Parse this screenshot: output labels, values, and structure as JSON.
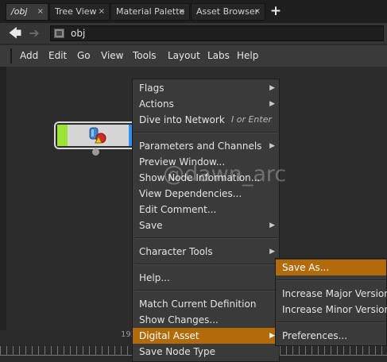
{
  "tabs": [
    {
      "label": "/obj",
      "close": "×"
    },
    {
      "label": "Tree View",
      "close": "×"
    },
    {
      "label": "Material Palette",
      "close": "×"
    },
    {
      "label": "Asset Browser",
      "close": "×"
    }
  ],
  "add_tab": "+",
  "path": {
    "back": "🡄",
    "forward": "➔",
    "value": "obj"
  },
  "menubar": [
    "Add",
    "Edit",
    "Go",
    "View",
    "Tools",
    "Layout",
    "Labs",
    "Help"
  ],
  "timeline": {
    "frame_label": "192"
  },
  "context_menu": {
    "items": [
      {
        "label": "Flags",
        "arrow": "▶"
      },
      {
        "label": "Actions",
        "arrow": "▶"
      },
      {
        "label": "Dive into Network",
        "hint": "I or Enter"
      },
      {
        "label": "Parameters and Channels",
        "arrow": "▶"
      },
      {
        "label": "Preview Window..."
      },
      {
        "label": "Show Node Information..."
      },
      {
        "label": "View Dependencies..."
      },
      {
        "label": "Edit Comment..."
      },
      {
        "label": "Save",
        "arrow": "▶"
      },
      {
        "label": "Character Tools",
        "arrow": "▶"
      },
      {
        "label": "Help..."
      },
      {
        "label": "Match Current Definition"
      },
      {
        "label": "Show Changes..."
      },
      {
        "label": "Digital Asset",
        "arrow": "▶"
      },
      {
        "label": "Save Node Type"
      }
    ]
  },
  "submenu": {
    "items": [
      {
        "label": "Save As..."
      },
      {
        "label": "Increase Major Version"
      },
      {
        "label": "Increase Minor Version"
      },
      {
        "label": "Preferences..."
      }
    ]
  },
  "watermark": "@dawn_arc",
  "colors": {
    "highlight": "#b36a0a",
    "node_green": "#9be336",
    "node_blue": "#2f8ef0"
  }
}
